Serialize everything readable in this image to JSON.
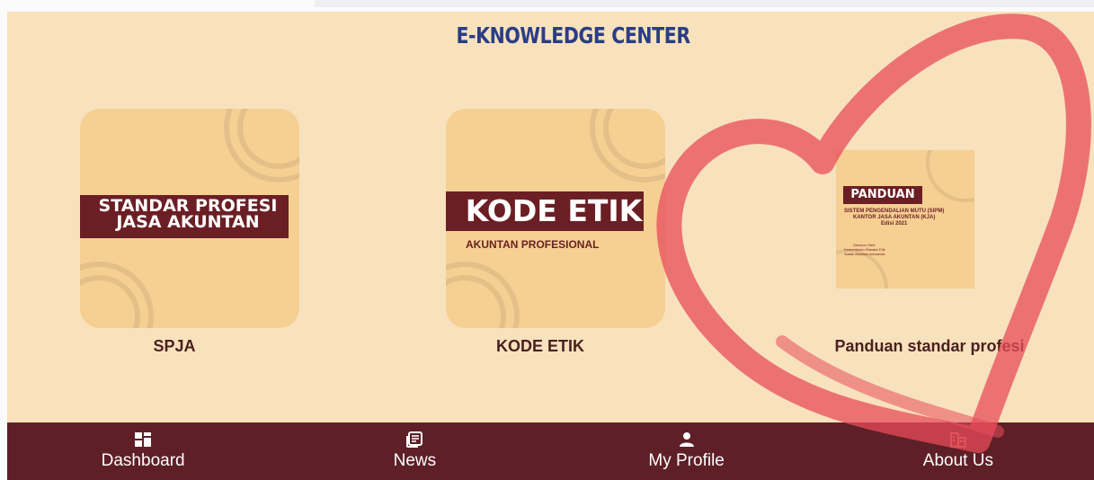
{
  "header": {
    "title": "E-KNOWLEDGE CENTER"
  },
  "items": [
    {
      "label": "SPJA",
      "cover_line1": "STANDAR PROFESI",
      "cover_line2": "JASA AKUNTAN"
    },
    {
      "label": "KODE ETIK",
      "cover_title": "KODE ETIK",
      "cover_subtitle": "AKUNTAN PROFESIONAL"
    },
    {
      "label": "Panduan standar profesi",
      "cover_title": "PANDUAN",
      "cover_line1": "SISTEM PENGENDALIAN MUTU (SIPM)",
      "cover_line2": "KANTOR JASA AKUNTAN (KJA)",
      "cover_line3": "Edisi 2021",
      "cover_small1": "Disusun Oleh:",
      "cover_small2": "Kementerian Standar Etik",
      "cover_small3": "Ikatan Akuntan Indonesia"
    }
  ],
  "nav": [
    {
      "label": "Dashboard",
      "icon": "dashboard-icon"
    },
    {
      "label": "News",
      "icon": "news-icon"
    },
    {
      "label": "My Profile",
      "icon": "profile-icon"
    },
    {
      "label": "About Us",
      "icon": "about-us-icon"
    }
  ],
  "colors": {
    "background": "#f8e2bd",
    "title": "#2a3d86",
    "navbar": "#5e1f27",
    "accent": "#6b1f24",
    "heart_overlay": "#e84c5a"
  }
}
